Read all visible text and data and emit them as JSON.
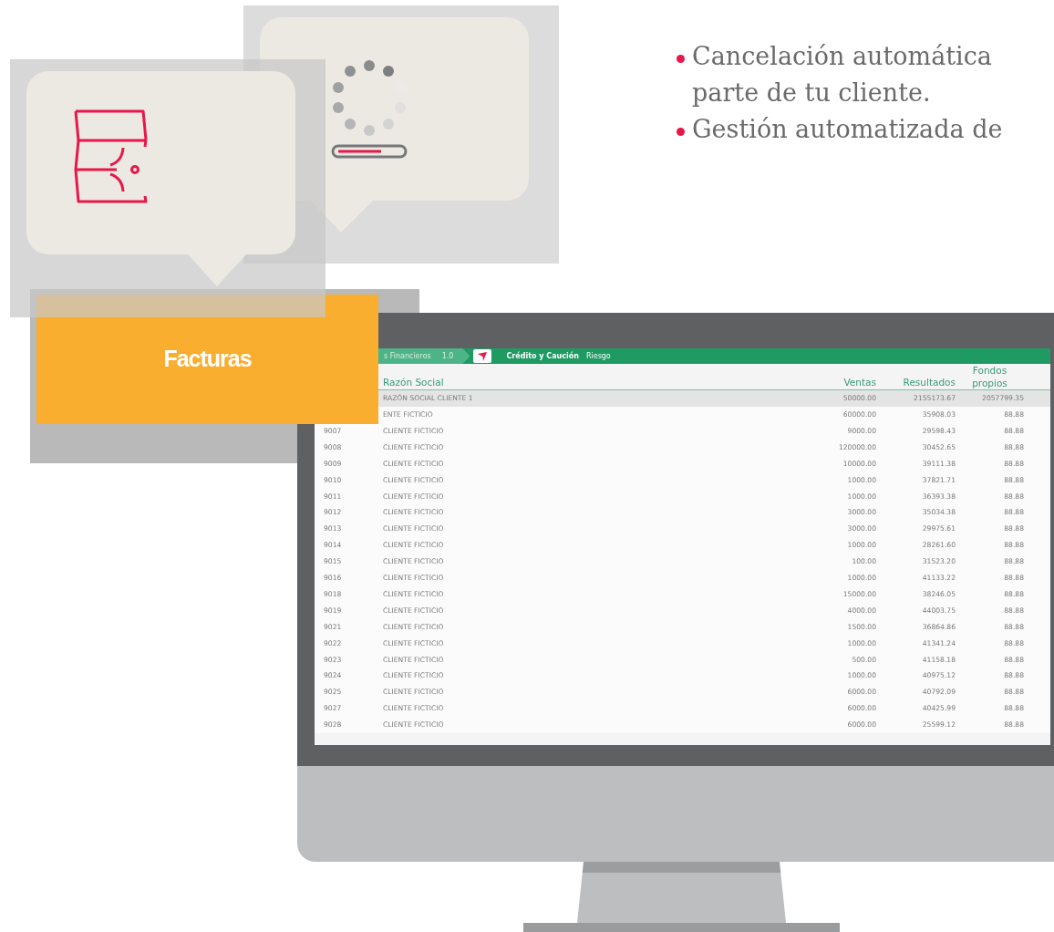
{
  "bullets": [
    {
      "lines": [
        "Cancelación automática",
        "parte de tu cliente."
      ]
    },
    {
      "lines": [
        "Gestión automatizada de"
      ]
    }
  ],
  "label_box": {
    "text": "Facturas"
  },
  "screen": {
    "breadcrumb": {
      "text": "s Financieros",
      "version": "1.0"
    },
    "app_title": "Crédito y Caución",
    "app_subtitle": "Riesgo",
    "table": {
      "columns": [
        {
          "label": "Razón Social"
        },
        {
          "label": "Ventas"
        },
        {
          "label": "Resultados"
        },
        {
          "label": "Fondos propios"
        }
      ],
      "rows": [
        {
          "name": "RAZÓN SOCIAL CLIENTE 1",
          "ventas": "50000.00",
          "resultados": "2155173.67",
          "fondos": "2057799.35",
          "selected": true
        },
        {
          "name": "ENTE FICTICIO",
          "ventas": "60000.00",
          "resultados": "35908.03",
          "fondos": "88.88",
          "selected": false
        },
        {
          "id": "9007",
          "name": "CLIENTE FICTICIO",
          "ventas": "9000.00",
          "resultados": "29598.43",
          "fondos": "88.88",
          "selected": false
        },
        {
          "id": "9008",
          "name": "CLIENTE FICTICIO",
          "ventas": "120000.00",
          "resultados": "30452.65",
          "fondos": "88.88",
          "selected": false
        },
        {
          "id": "9009",
          "name": "CLIENTE FICTICIO",
          "ventas": "10000.00",
          "resultados": "39111.38",
          "fondos": "88.88",
          "selected": false
        },
        {
          "id": "9010",
          "name": "CLIENTE FICTICIO",
          "ventas": "1000.00",
          "resultados": "37821.71",
          "fondos": "88.88",
          "selected": false
        },
        {
          "id": "9011",
          "name": "CLIENTE FICTICIO",
          "ventas": "1000.00",
          "resultados": "36393.38",
          "fondos": "88.88",
          "selected": false
        },
        {
          "id": "9012",
          "name": "CLIENTE FICTICIO",
          "ventas": "3000.00",
          "resultados": "35034.38",
          "fondos": "88.88",
          "selected": false
        },
        {
          "id": "9013",
          "name": "CLIENTE FICTICIO",
          "ventas": "3000.00",
          "resultados": "29975.61",
          "fondos": "88.88",
          "selected": false
        },
        {
          "id": "9014",
          "name": "CLIENTE FICTICIO",
          "ventas": "1000.00",
          "resultados": "28261.60",
          "fondos": "88.88",
          "selected": false
        },
        {
          "id": "9015",
          "name": "CLIENTE FICTICIO",
          "ventas": "100.00",
          "resultados": "31523.20",
          "fondos": "88.88",
          "selected": false
        },
        {
          "id": "9016",
          "name": "CLIENTE FICTICIO",
          "ventas": "1000.00",
          "resultados": "41133.22",
          "fondos": "88.88",
          "selected": false
        },
        {
          "id": "9018",
          "name": "CLIENTE FICTICIO",
          "ventas": "15000.00",
          "resultados": "38246.05",
          "fondos": "88.88",
          "selected": false
        },
        {
          "id": "9019",
          "name": "CLIENTE FICTICIO",
          "ventas": "4000.00",
          "resultados": "44003.75",
          "fondos": "88.88",
          "selected": false
        },
        {
          "id": "9021",
          "name": "CLIENTE FICTICIO",
          "ventas": "1500.00",
          "resultados": "36864.86",
          "fondos": "88.88",
          "selected": false
        },
        {
          "id": "9022",
          "name": "CLIENTE FICTICIO",
          "ventas": "1000.00",
          "resultados": "41341.24",
          "fondos": "88.88",
          "selected": false
        },
        {
          "id": "9023",
          "name": "CLIENTE FICTICIO",
          "ventas": "500.00",
          "resultados": "41158.18",
          "fondos": "88.88",
          "selected": false
        },
        {
          "id": "9024",
          "name": "CLIENTE FICTICIO",
          "ventas": "1000.00",
          "resultados": "40975.12",
          "fondos": "88.88",
          "selected": false
        },
        {
          "id": "9025",
          "name": "CLIENTE FICTICIO",
          "ventas": "6000.00",
          "resultados": "40792.09",
          "fondos": "88.88",
          "selected": false
        },
        {
          "id": "9027",
          "name": "CLIENTE FICTICIO",
          "ventas": "6000.00",
          "resultados": "40425.99",
          "fondos": "88.88",
          "selected": false
        },
        {
          "id": "9028",
          "name": "CLIENTE FICTICIO",
          "ventas": "6000.00",
          "resultados": "25599.12",
          "fondos": "88.88",
          "selected": false
        }
      ]
    }
  }
}
